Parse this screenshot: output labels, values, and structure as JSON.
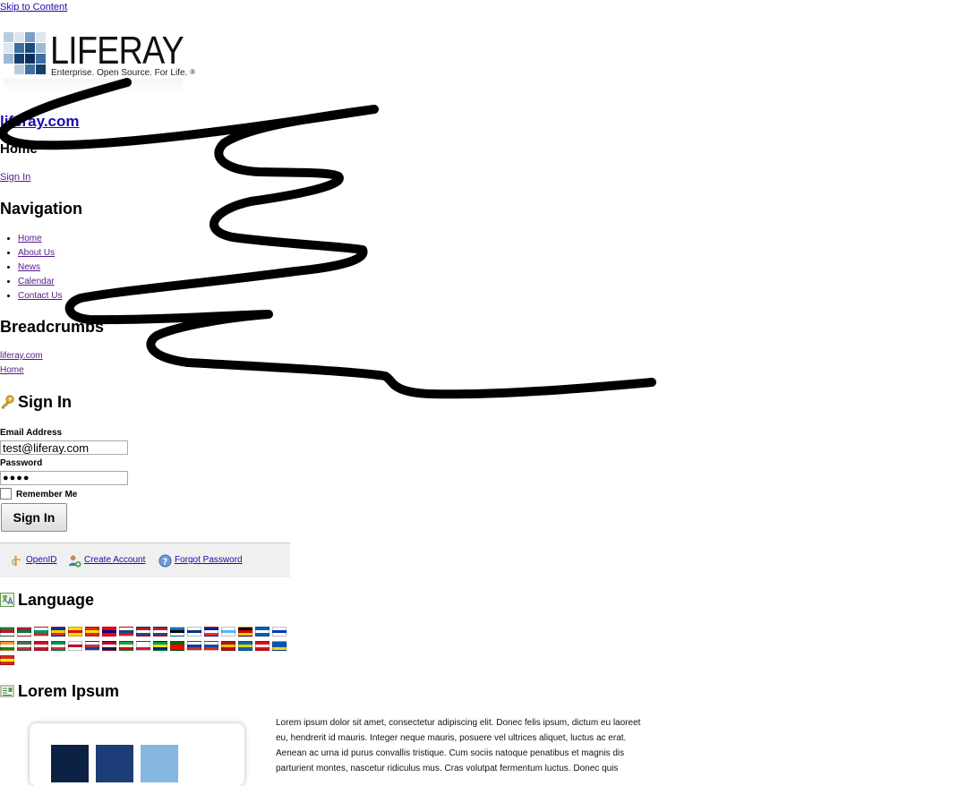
{
  "skip_link": "Skip to Content",
  "logo": {
    "wordmark": "LIFERAY",
    "tagline": "Enterprise. Open Source. For Life.",
    "reg": "®"
  },
  "site_link": "liferay.com",
  "page_title": "Home",
  "sign_in_link": "Sign In",
  "navigation": {
    "heading": "Navigation",
    "items": [
      "Home",
      "About Us",
      "News",
      "Calendar",
      "Contact Us"
    ]
  },
  "breadcrumbs": {
    "heading": "Breadcrumbs",
    "items": [
      "liferay.com",
      "Home"
    ]
  },
  "sign_in_portlet": {
    "heading": "Sign In",
    "email_label": "Email Address",
    "email_value": "test@liferay.com",
    "password_label": "Password",
    "password_value": "●●●●",
    "remember_label": "Remember Me",
    "button_label": "Sign In",
    "links": {
      "openid": "OpenID",
      "create_account": "Create Account",
      "forgot_password": "Forgot Password"
    }
  },
  "language": {
    "heading": "Language",
    "flag_colors": [
      [
        "#1f7a2e",
        "#c8102e",
        "#ffffff"
      ],
      [
        "#c8102e",
        "#007a3d",
        "#ffffff"
      ],
      [
        "#ffffff",
        "#00966e",
        "#d62612"
      ],
      [
        "#0032a0",
        "#ffd100",
        "#d52b1e"
      ],
      [
        "#fcdd09",
        "#da121a",
        "#fcdd09"
      ],
      [
        "#de2910",
        "#ffde00",
        "#de2910"
      ],
      [
        "#fe0000",
        "#000095",
        "#fe0000"
      ],
      [
        "#ffffff",
        "#11457e",
        "#d7141a"
      ],
      [
        "#ae1c28",
        "#ffffff",
        "#21468b"
      ],
      [
        "#b22234",
        "#ffffff",
        "#3c3b6e"
      ],
      [
        "#0072ce",
        "#000000",
        "#ffffff"
      ],
      [
        "#ffffff",
        "#003580",
        "#ffffff"
      ],
      [
        "#002395",
        "#ffffff",
        "#ed2939"
      ],
      [
        "#ffffff",
        "#4db8ff",
        "#ffffff"
      ],
      [
        "#000000",
        "#dd0000",
        "#ffce00"
      ],
      [
        "#0d5eaf",
        "#ffffff",
        "#0d5eaf"
      ],
      [
        "#ffffff",
        "#0038b8",
        "#ffffff"
      ],
      [
        "#ff9933",
        "#ffffff",
        "#138808"
      ],
      [
        "#477050",
        "#ffffff",
        "#ce2939"
      ],
      [
        "#ce1126",
        "#ffffff",
        "#ce1126"
      ],
      [
        "#009246",
        "#ffffff",
        "#ce2b37"
      ],
      [
        "#ffffff",
        "#bc002d",
        "#ffffff"
      ],
      [
        "#ffffff",
        "#cd2e3a",
        "#0047a0"
      ],
      [
        "#ba0c2f",
        "#ffffff",
        "#00205b"
      ],
      [
        "#239f40",
        "#ffffff",
        "#da0000"
      ],
      [
        "#ffffff",
        "#ffffff",
        "#dc143c"
      ],
      [
        "#009c3b",
        "#ffdf00",
        "#002776"
      ],
      [
        "#006600",
        "#ff0000",
        "#ff0000"
      ],
      [
        "#ffffff",
        "#0039a6",
        "#d52b1e"
      ],
      [
        "#ffffff",
        "#0b4ea2",
        "#ee1c25"
      ],
      [
        "#aa151b",
        "#f1bf00",
        "#aa151b"
      ],
      [
        "#006aa7",
        "#fecc00",
        "#006aa7"
      ],
      [
        "#e30a17",
        "#ffffff",
        "#e30a17"
      ],
      [
        "#0057b7",
        "#0057b7",
        "#ffd700"
      ],
      [
        "#da251d",
        "#ffff00",
        "#da251d"
      ]
    ]
  },
  "lorem": {
    "heading": "Lorem Ipsum",
    "lines": [
      "Lorem ipsum dolor sit amet, consectetur adipiscing elit. Donec felis ipsum, dictum eu laoreet",
      "eu, hendrerit id mauris. Integer neque mauris, posuere vel ultrices aliquet, luctus ac erat.",
      "Aenean ac urna id purus convallis tristique. Cum sociis natoque penatibus et magnis dis",
      "parturient montes, nascetur ridiculus mus. Cras volutpat fermentum luctus. Donec quis"
    ],
    "square_colors": [
      "#0c2244",
      "#1c3d77",
      "#86b7e2"
    ]
  }
}
